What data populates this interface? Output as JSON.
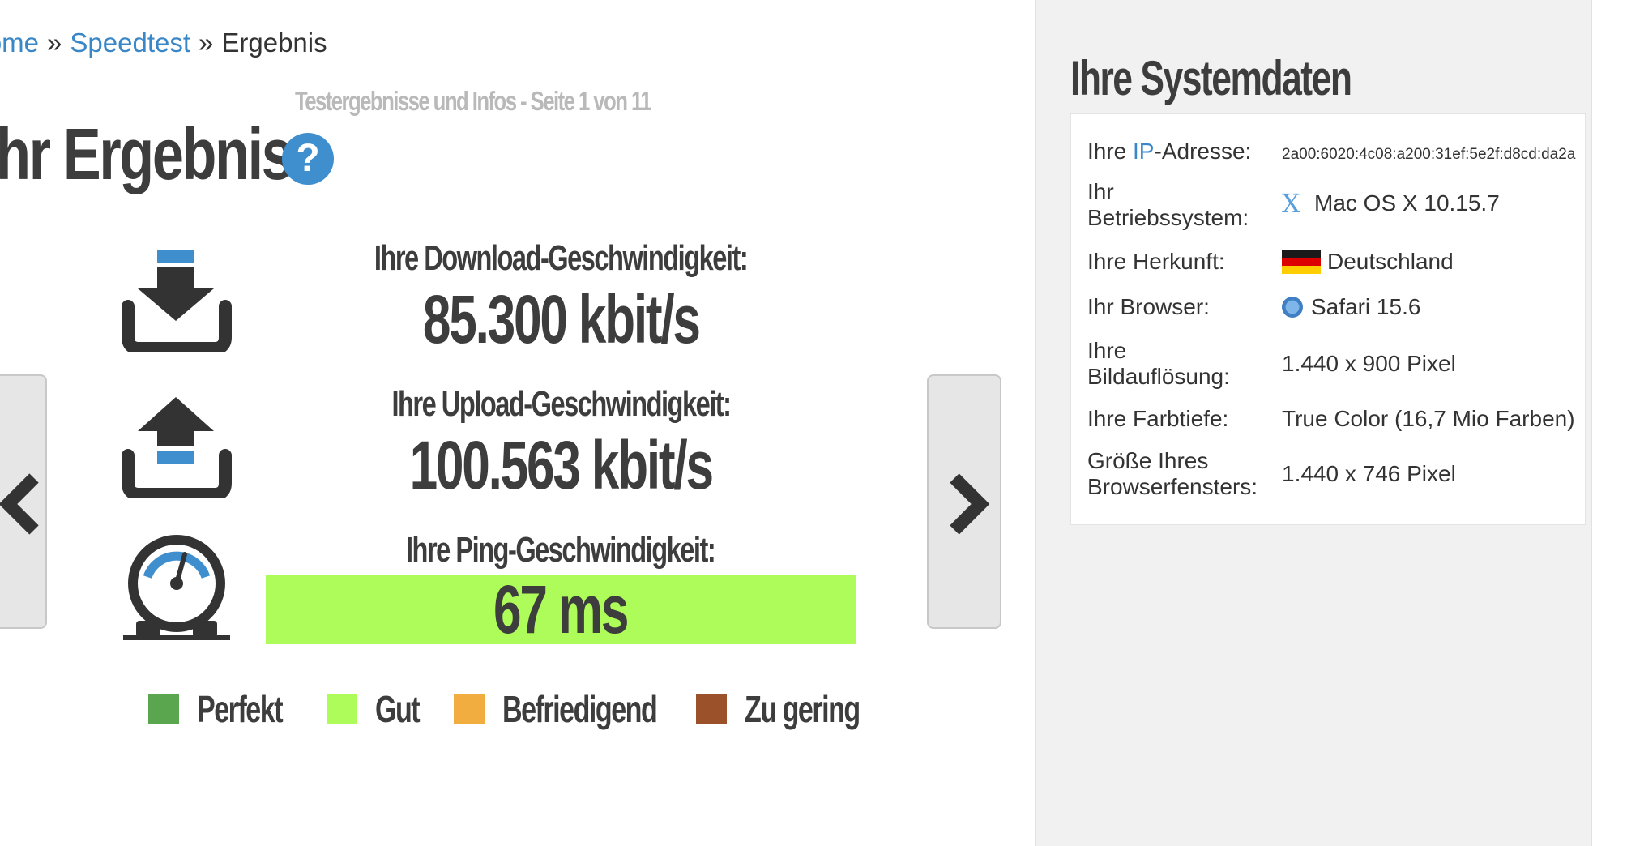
{
  "breadcrumb": {
    "home": "Home",
    "sep1": "»",
    "speedtest": "Speedtest",
    "sep2": "»",
    "current": "Ergebnis"
  },
  "page_info": "Testergebnisse und Infos - Seite 1 von 11",
  "result_title": "Ihr Ergebnis",
  "help_icon_label": "?",
  "download": {
    "label": "Ihre Download-Geschwindigkeit:",
    "value": "85.300 kbit/s",
    "icon": "download-icon"
  },
  "upload": {
    "label": "Ihre Upload-Geschwindigkeit:",
    "value": "100.563 kbit/s",
    "icon": "upload-icon"
  },
  "ping": {
    "label": "Ihre Ping-Geschwindigkeit:",
    "value": "67 ms",
    "icon": "gauge-icon",
    "bar_color": "#aefc5a"
  },
  "legend": [
    {
      "label": "Perfekt",
      "color": "#5aa64f"
    },
    {
      "label": "Gut",
      "color": "#aefc5a"
    },
    {
      "label": "Befriedigend",
      "color": "#f2ad40"
    },
    {
      "label": "Zu gering",
      "color": "#9b522a"
    }
  ],
  "nav": {
    "prev_icon": "chevron-left-icon",
    "next_icon": "chevron-right-icon"
  },
  "sidebar": {
    "title": "Ihre Systemdaten",
    "rows": [
      {
        "key_pre": "Ihre ",
        "key_link": "IP",
        "key_post": "-Adresse:",
        "value": "2a00:6020:4c08:a200:31ef:5e2f:d8cd:da2a"
      },
      {
        "key": "Ihr Betriebssystem:",
        "value": "Mac OS X 10.15.7",
        "icon": "macos-x-icon"
      },
      {
        "key": "Ihre Herkunft:",
        "value": "Deutschland",
        "icon": "germany-flag-icon"
      },
      {
        "key": "Ihr Browser:",
        "value": "Safari 15.6",
        "icon": "safari-icon"
      },
      {
        "key": "Ihre Bildauflösung:",
        "value": "1.440 x 900 Pixel"
      },
      {
        "key": "Ihre Farbtiefe:",
        "value": "True Color (16,7 Mio Farben)"
      },
      {
        "key": "Größe Ihres Browserfensters:",
        "value": "1.440 x 746 Pixel"
      }
    ]
  },
  "colors": {
    "accent": "#3a87c8",
    "text_dark": "#3d3d3d",
    "sidebar_bg": "#f1f1f1"
  }
}
